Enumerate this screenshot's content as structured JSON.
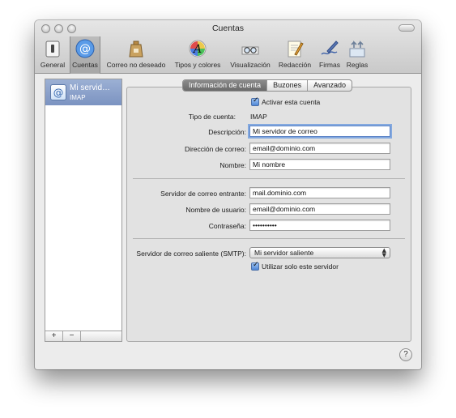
{
  "window": {
    "title": "Cuentas"
  },
  "toolbar": {
    "items": [
      {
        "label": "General",
        "icon": "general-switch-icon"
      },
      {
        "label": "Cuentas",
        "icon": "at-sign-icon",
        "selected": true
      },
      {
        "label": "Correo no deseado",
        "icon": "junk-mail-bag-icon"
      },
      {
        "label": "Tipos y colores",
        "icon": "font-colors-icon"
      },
      {
        "label": "Visualización",
        "icon": "eyeglasses-icon"
      },
      {
        "label": "Redacción",
        "icon": "compose-pencil-icon"
      },
      {
        "label": "Firmas",
        "icon": "signature-pen-icon"
      },
      {
        "label": "Reglas",
        "icon": "rules-icon"
      }
    ]
  },
  "sidebar": {
    "accounts": [
      {
        "name": "Mi servid…",
        "type": "IMAP"
      }
    ],
    "add_label": "+",
    "remove_label": "−"
  },
  "tabs": [
    {
      "label": "Información de cuenta",
      "active": true
    },
    {
      "label": "Buzones",
      "active": false
    },
    {
      "label": "Avanzado",
      "active": false
    }
  ],
  "form": {
    "enable_label": "Activar esta cuenta",
    "enable_checked": true,
    "account_type_label": "Tipo de cuenta:",
    "account_type_value": "IMAP",
    "description_label": "Descripción:",
    "description_value": "Mi servidor de correo",
    "email_label": "Dirección de correo:",
    "email_value": "email@dominio.com",
    "name_label": "Nombre:",
    "name_value": "Mi nombre",
    "incoming_label": "Servidor de correo entrante:",
    "incoming_value": "mail.dominio.com",
    "username_label": "Nombre de usuario:",
    "username_value": "email@dominio.com",
    "password_label": "Contraseña:",
    "password_value": "••••••••••",
    "smtp_label": "Servidor de correo saliente (SMTP):",
    "smtp_value": "Mi servidor saliente",
    "only_server_label": "Utilizar solo este servidor",
    "only_server_checked": true
  },
  "help_label": "?",
  "colors": {
    "selection": "#7b93c1",
    "tab_active": "#6a6a6a",
    "focus_ring": "#84a9df"
  }
}
